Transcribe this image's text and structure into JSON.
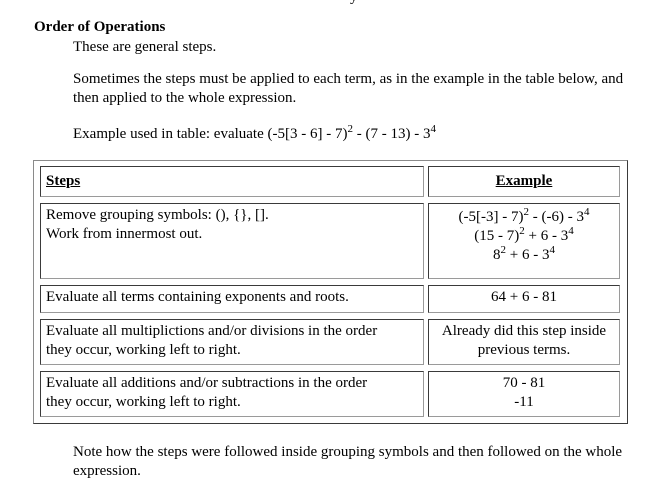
{
  "page": {
    "top_fragment": "y",
    "heading": "Order of Operations",
    "intro": "These are general steps.",
    "note_terms": "Sometimes the steps must be applied to each term, as in the example in the table below, and then applied to the whole expression.",
    "example_prefix": "Example used in table:  evaluate (-5[3 - 6] - 7)",
    "example_exp1": "2",
    "example_mid": " - (7 - 13) - 3",
    "example_exp2": "4",
    "footer": "Note how the steps were followed inside grouping symbols and then followed on the whole expression."
  },
  "table": {
    "header_steps": "Steps",
    "header_example": "Example",
    "rows": [
      {
        "step_line1": "Remove grouping symbols: (), {}, [].",
        "step_line2": "Work from innermost out.",
        "ex1_a": "(-5[-3] - 7)",
        "ex1_b": "2",
        "ex1_c": " - (-6) - 3",
        "ex1_d": "4",
        "ex2_a": "(15 - 7)",
        "ex2_b": "2",
        "ex2_c": " + 6 - 3",
        "ex2_d": "4",
        "ex3_a": "8",
        "ex3_b": "2",
        "ex3_c": " + 6 - 3",
        "ex3_d": "4"
      },
      {
        "step_line1": "Evaluate all terms containing exponents and roots.",
        "ex1": "64 + 6 - 81"
      },
      {
        "step_line1": "Evaluate all multiplictions and/or divisions in the order",
        "step_line2": "they occur, working left to right.",
        "ex1": "Already did this step inside",
        "ex2": "previous terms."
      },
      {
        "step_line1": "Evaluate all additions and/or subtractions in the order",
        "step_line2": "they occur, working left to right.",
        "ex1": "70 - 81",
        "ex2": "-11"
      }
    ]
  }
}
